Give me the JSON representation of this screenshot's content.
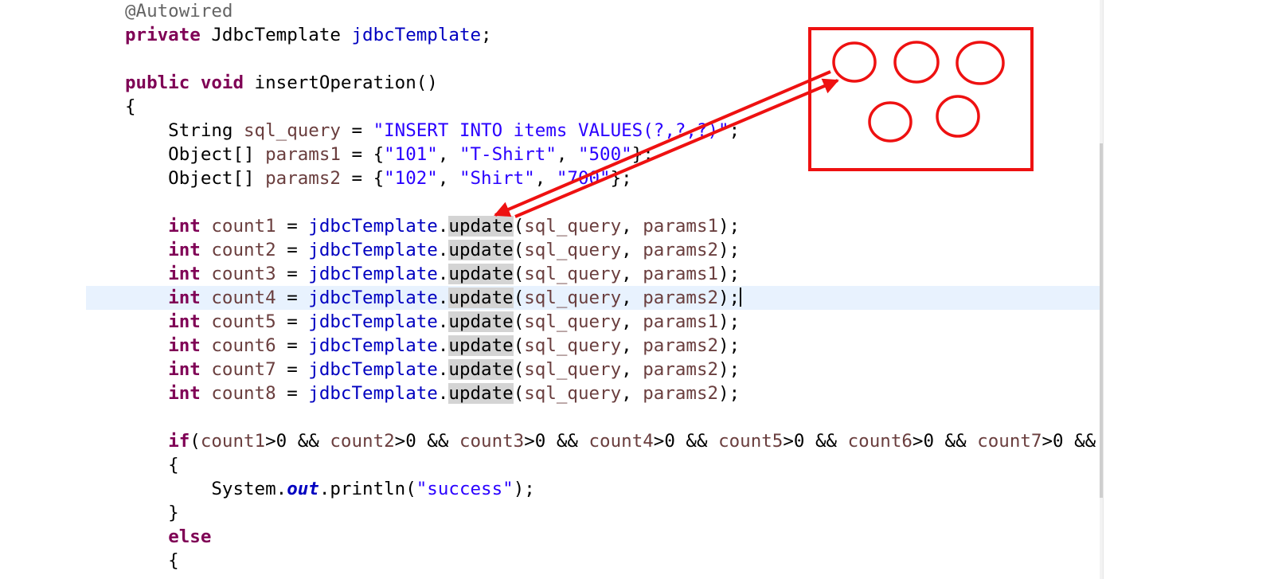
{
  "editor": {
    "language": "java",
    "current_line": 13,
    "lines": [
      {
        "tokens": [
          {
            "t": "@Autowired",
            "c": "ann"
          }
        ]
      },
      {
        "tokens": [
          {
            "t": "private",
            "c": "kw"
          },
          {
            "t": " JdbcTemplate "
          },
          {
            "t": "jdbcTemplate",
            "c": "field"
          },
          {
            "t": ";"
          }
        ]
      },
      {
        "tokens": []
      },
      {
        "tokens": [
          {
            "t": "public",
            "c": "kw"
          },
          {
            "t": " "
          },
          {
            "t": "void",
            "c": "kw"
          },
          {
            "t": " insertOperation()"
          }
        ]
      },
      {
        "tokens": [
          {
            "t": "{"
          }
        ]
      },
      {
        "tokens": [
          {
            "t": "    String "
          },
          {
            "t": "sql_query",
            "c": "var"
          },
          {
            "t": " = "
          },
          {
            "t": "\"INSERT INTO items VALUES(?,?,?)\"",
            "c": "str"
          },
          {
            "t": ";"
          }
        ]
      },
      {
        "tokens": [
          {
            "t": "    Object[] "
          },
          {
            "t": "params1",
            "c": "var"
          },
          {
            "t": " = {"
          },
          {
            "t": "\"101\"",
            "c": "str"
          },
          {
            "t": ", "
          },
          {
            "t": "\"T-Shirt\"",
            "c": "str"
          },
          {
            "t": ", "
          },
          {
            "t": "\"500\"",
            "c": "str"
          },
          {
            "t": "};"
          }
        ]
      },
      {
        "tokens": [
          {
            "t": "    Object[] "
          },
          {
            "t": "params2",
            "c": "var"
          },
          {
            "t": " = {"
          },
          {
            "t": "\"102\"",
            "c": "str"
          },
          {
            "t": ", "
          },
          {
            "t": "\"Shirt\"",
            "c": "str"
          },
          {
            "t": ", "
          },
          {
            "t": "\"700\"",
            "c": "str"
          },
          {
            "t": "};"
          }
        ]
      },
      {
        "tokens": []
      },
      {
        "tokens": [
          {
            "t": "    "
          },
          {
            "t": "int",
            "c": "kw"
          },
          {
            "t": " "
          },
          {
            "t": "count1",
            "c": "var"
          },
          {
            "t": " = "
          },
          {
            "t": "jdbcTemplate",
            "c": "field"
          },
          {
            "t": "."
          },
          {
            "t": "update",
            "c": "hl"
          },
          {
            "t": "("
          },
          {
            "t": "sql_query",
            "c": "var"
          },
          {
            "t": ", "
          },
          {
            "t": "params1",
            "c": "var"
          },
          {
            "t": ");"
          }
        ]
      },
      {
        "tokens": [
          {
            "t": "    "
          },
          {
            "t": "int",
            "c": "kw"
          },
          {
            "t": " "
          },
          {
            "t": "count2",
            "c": "var"
          },
          {
            "t": " = "
          },
          {
            "t": "jdbcTemplate",
            "c": "field"
          },
          {
            "t": "."
          },
          {
            "t": "update",
            "c": "hl"
          },
          {
            "t": "("
          },
          {
            "t": "sql_query",
            "c": "var"
          },
          {
            "t": ", "
          },
          {
            "t": "params2",
            "c": "var"
          },
          {
            "t": ");"
          }
        ]
      },
      {
        "tokens": [
          {
            "t": "    "
          },
          {
            "t": "int",
            "c": "kw"
          },
          {
            "t": " "
          },
          {
            "t": "count3",
            "c": "var"
          },
          {
            "t": " = "
          },
          {
            "t": "jdbcTemplate",
            "c": "field"
          },
          {
            "t": "."
          },
          {
            "t": "update",
            "c": "hl"
          },
          {
            "t": "("
          },
          {
            "t": "sql_query",
            "c": "var"
          },
          {
            "t": ", "
          },
          {
            "t": "params1",
            "c": "var"
          },
          {
            "t": ");"
          }
        ]
      },
      {
        "tokens": [
          {
            "t": "    "
          },
          {
            "t": "int",
            "c": "kw"
          },
          {
            "t": " "
          },
          {
            "t": "count4",
            "c": "var"
          },
          {
            "t": " = "
          },
          {
            "t": "jdbcTemplate",
            "c": "field"
          },
          {
            "t": "."
          },
          {
            "t": "update",
            "c": "hl"
          },
          {
            "t": "("
          },
          {
            "t": "sql_query",
            "c": "var"
          },
          {
            "t": ", "
          },
          {
            "t": "params2",
            "c": "var"
          },
          {
            "t": ");"
          }
        ]
      },
      {
        "tokens": [
          {
            "t": "    "
          },
          {
            "t": "int",
            "c": "kw"
          },
          {
            "t": " "
          },
          {
            "t": "count5",
            "c": "var"
          },
          {
            "t": " = "
          },
          {
            "t": "jdbcTemplate",
            "c": "field"
          },
          {
            "t": "."
          },
          {
            "t": "update",
            "c": "hl"
          },
          {
            "t": "("
          },
          {
            "t": "sql_query",
            "c": "var"
          },
          {
            "t": ", "
          },
          {
            "t": "params1",
            "c": "var"
          },
          {
            "t": ");"
          }
        ]
      },
      {
        "tokens": [
          {
            "t": "    "
          },
          {
            "t": "int",
            "c": "kw"
          },
          {
            "t": " "
          },
          {
            "t": "count6",
            "c": "var"
          },
          {
            "t": " = "
          },
          {
            "t": "jdbcTemplate",
            "c": "field"
          },
          {
            "t": "."
          },
          {
            "t": "update",
            "c": "hl"
          },
          {
            "t": "("
          },
          {
            "t": "sql_query",
            "c": "var"
          },
          {
            "t": ", "
          },
          {
            "t": "params2",
            "c": "var"
          },
          {
            "t": ");"
          }
        ]
      },
      {
        "tokens": [
          {
            "t": "    "
          },
          {
            "t": "int",
            "c": "kw"
          },
          {
            "t": " "
          },
          {
            "t": "count7",
            "c": "var"
          },
          {
            "t": " = "
          },
          {
            "t": "jdbcTemplate",
            "c": "field"
          },
          {
            "t": "."
          },
          {
            "t": "update",
            "c": "hl"
          },
          {
            "t": "("
          },
          {
            "t": "sql_query",
            "c": "var"
          },
          {
            "t": ", "
          },
          {
            "t": "params2",
            "c": "var"
          },
          {
            "t": ");"
          }
        ]
      },
      {
        "tokens": [
          {
            "t": "    "
          },
          {
            "t": "int",
            "c": "kw"
          },
          {
            "t": " "
          },
          {
            "t": "count8",
            "c": "var"
          },
          {
            "t": " = "
          },
          {
            "t": "jdbcTemplate",
            "c": "field"
          },
          {
            "t": "."
          },
          {
            "t": "update",
            "c": "hl"
          },
          {
            "t": "("
          },
          {
            "t": "sql_query",
            "c": "var"
          },
          {
            "t": ", "
          },
          {
            "t": "params2",
            "c": "var"
          },
          {
            "t": ");"
          }
        ]
      },
      {
        "tokens": []
      },
      {
        "tokens": [
          {
            "t": "    "
          },
          {
            "t": "if",
            "c": "kw"
          },
          {
            "t": "("
          },
          {
            "t": "count1",
            "c": "var"
          },
          {
            "t": ">0 && "
          },
          {
            "t": "count2",
            "c": "var"
          },
          {
            "t": ">0 && "
          },
          {
            "t": "count3",
            "c": "var"
          },
          {
            "t": ">0 && "
          },
          {
            "t": "count4",
            "c": "var"
          },
          {
            "t": ">0 && "
          },
          {
            "t": "count5",
            "c": "var"
          },
          {
            "t": ">0 && "
          },
          {
            "t": "count6",
            "c": "var"
          },
          {
            "t": ">0 && "
          },
          {
            "t": "count7",
            "c": "var"
          },
          {
            "t": ">0 && "
          }
        ]
      },
      {
        "tokens": [
          {
            "t": "    {"
          }
        ]
      },
      {
        "tokens": [
          {
            "t": "        System."
          },
          {
            "t": "out",
            "c": "static"
          },
          {
            "t": ".println("
          },
          {
            "t": "\"success\"",
            "c": "str"
          },
          {
            "t": ");"
          }
        ]
      },
      {
        "tokens": [
          {
            "t": "    }"
          }
        ]
      },
      {
        "tokens": [
          {
            "t": "    "
          },
          {
            "t": "else",
            "c": "kw"
          }
        ]
      },
      {
        "tokens": [
          {
            "t": "    {"
          }
        ]
      }
    ]
  },
  "annotation": {
    "stroke_color": "#ee1111",
    "shape_names": [
      "box",
      "circle",
      "circle",
      "circle",
      "circle",
      "circle",
      "arrow",
      "arrow"
    ]
  },
  "colors": {
    "keyword": "#7f0055",
    "string": "#2a00ff",
    "field": "#0000c0",
    "local_var": "#6a3e3e",
    "annotation": "#646464",
    "occurrence_highlight": "#d4d4d4",
    "current_line": "#e8f2fe"
  }
}
